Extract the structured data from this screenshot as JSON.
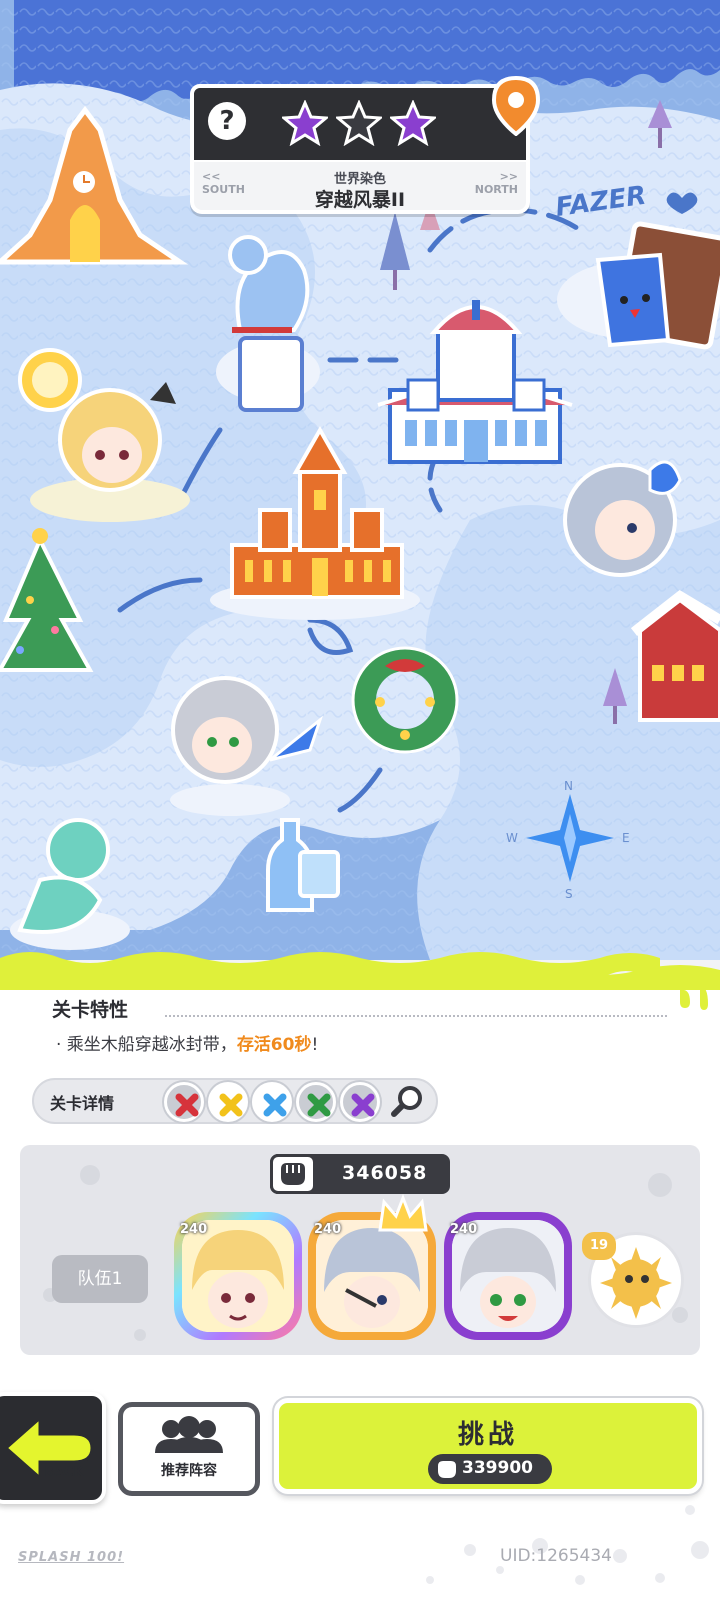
{
  "stage": {
    "subtitle": "世界染色",
    "title": "穿越风暴II",
    "left_dir": "<<",
    "left_label": "SOUTH",
    "right_dir": ">>",
    "right_label": "NORTH",
    "help": "?",
    "stars": [
      "purple",
      "grey",
      "purple"
    ]
  },
  "map": {
    "fazer_label": "FAZER",
    "compass": {
      "n": "N",
      "s": "S",
      "w": "W",
      "e": "E"
    }
  },
  "trait": {
    "heading": "关卡特性",
    "text_prefix": "· 乘坐木船穿越冰封带，",
    "text_highlight": "存活60秒",
    "text_suffix": "!"
  },
  "details": {
    "label": "关卡详情",
    "elements": [
      {
        "name": "red",
        "color": "#d6333b"
      },
      {
        "name": "yellow",
        "color": "#f2c21b"
      },
      {
        "name": "blue",
        "color": "#3ea1ea"
      },
      {
        "name": "green",
        "color": "#2f9a43"
      },
      {
        "name": "purple",
        "color": "#8a3fcf"
      }
    ]
  },
  "team": {
    "power": "346058",
    "label": "队伍1",
    "members": [
      {
        "level": "240",
        "frame": "rainbow"
      },
      {
        "level": "240",
        "frame": "orange"
      },
      {
        "level": "240",
        "frame": "purple"
      }
    ],
    "pet_level": "19"
  },
  "buttons": {
    "back": "BACK",
    "recommend": "推荐阵容",
    "challenge": "挑战",
    "required_power": "339900"
  },
  "footer": {
    "logo": "SPLASH 100!",
    "uid": "UID:1265434"
  }
}
